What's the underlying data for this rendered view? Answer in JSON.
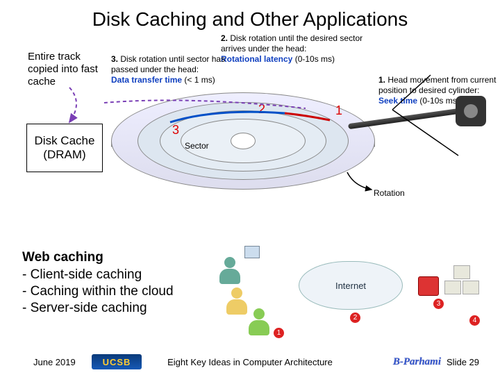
{
  "title": "Disk Caching and Other Applications",
  "left_note": "Entire track copied into fast cache",
  "cache_box": "Disk Cache (DRAM)",
  "annotations": {
    "step1": {
      "lead": "1.",
      "text": " Head movement from current position to desired cylinder:",
      "term": "Seek time",
      "tail": " (0-10s ms)"
    },
    "step2": {
      "lead": "2.",
      "text": " Disk rotation until the desired sector arrives under the head:",
      "term": "Rotational latency",
      "tail": " (0-10s ms)"
    },
    "step3": {
      "lead": "3.",
      "text": " Disk rotation until sector has passed under the head:",
      "term": "Data transfer time",
      "tail": " (< 1 ms)"
    },
    "sector": "Sector",
    "rotation": "Rotation",
    "n1": "1",
    "n2": "2",
    "n3": "3"
  },
  "web": {
    "heading": "Web caching",
    "items": [
      "- Client-side caching",
      "- Caching within the cloud",
      "- Server-side caching"
    ],
    "cloud": "Internet",
    "badges": [
      "1",
      "2",
      "3",
      "4"
    ]
  },
  "footer": {
    "date": "June 2019",
    "ucsb": "UCSB",
    "center": "Eight Key Ideas in Computer Architecture",
    "author": "B-Parhami",
    "slide": "Slide 29"
  }
}
